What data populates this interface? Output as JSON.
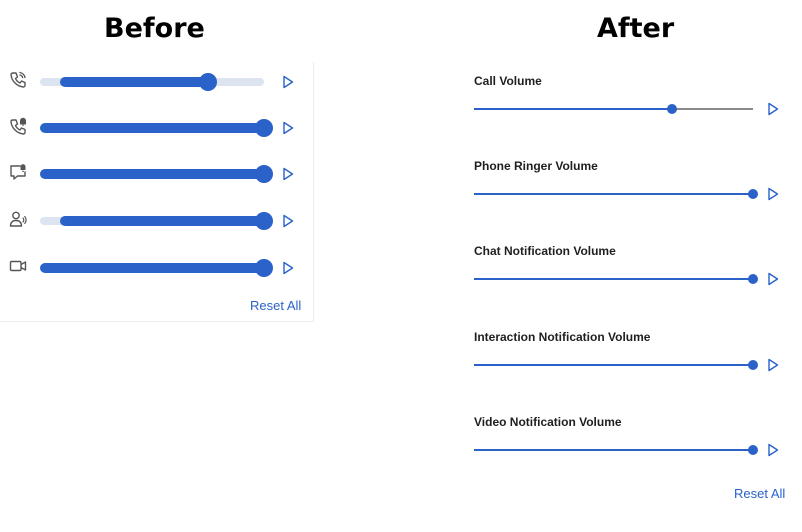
{
  "before": {
    "heading": "Before",
    "rows": [
      {
        "icon": "phone-volume-icon",
        "value": 0.75
      },
      {
        "icon": "phone-ringer-icon",
        "value": 1.0
      },
      {
        "icon": "chat-notification-icon",
        "value": 1.0
      },
      {
        "icon": "interaction-notification-icon",
        "value": 1.0
      },
      {
        "icon": "video-camera-icon",
        "value": 1.0
      }
    ],
    "reset_label": "Reset All"
  },
  "after": {
    "heading": "After",
    "items": [
      {
        "label": "Call Volume",
        "value": 0.71
      },
      {
        "label": "Phone Ringer Volume",
        "value": 1.0
      },
      {
        "label": "Chat Notification Volume",
        "value": 1.0
      },
      {
        "label": "Interaction Notification Volume",
        "value": 1.0
      },
      {
        "label": "Video Notification Volume",
        "value": 1.0
      }
    ],
    "reset_label": "Reset All"
  },
  "colors": {
    "accent": "#2a62c9",
    "track_light": "#dde4f1",
    "track_gray": "#8a8a8a"
  }
}
